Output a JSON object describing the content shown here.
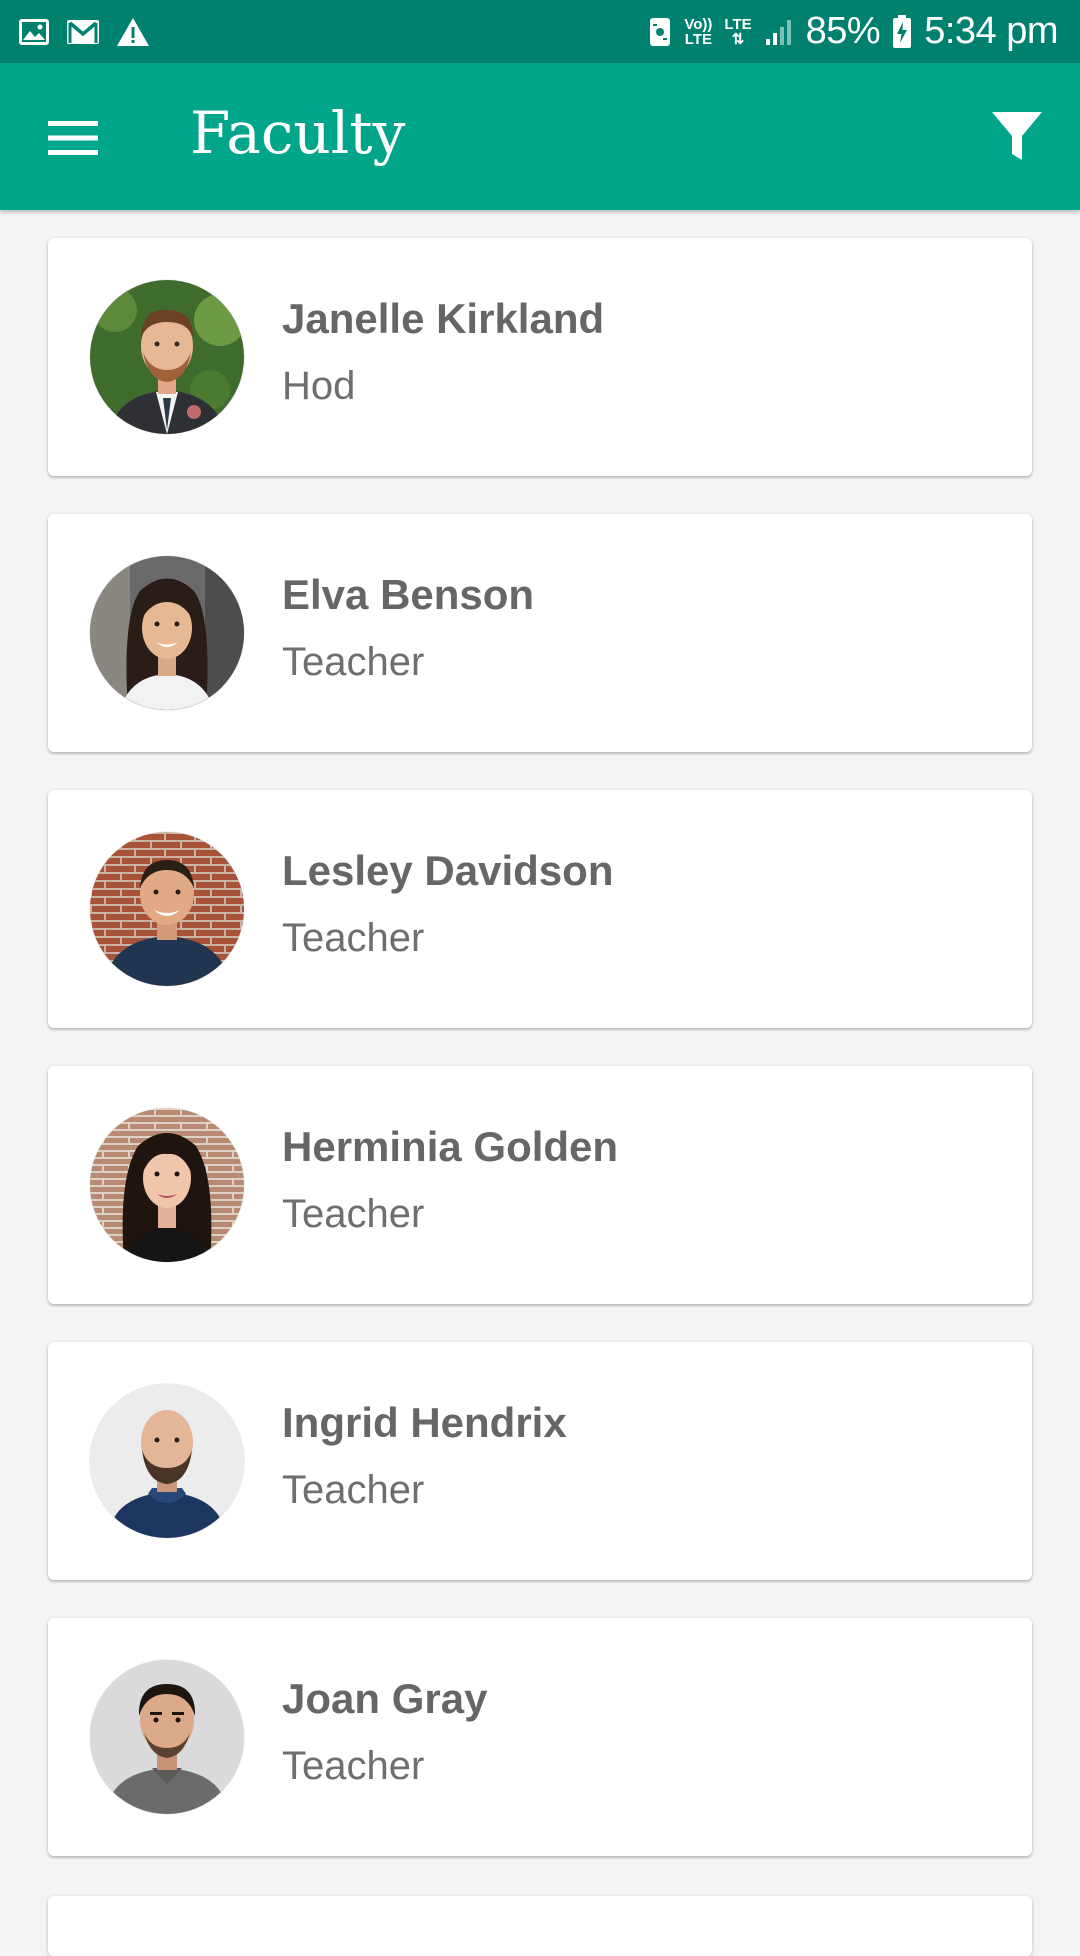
{
  "status_bar": {
    "left_icons": [
      "image-icon",
      "gmail-icon",
      "warning-icon"
    ],
    "right_icons": [
      "vibrate-icon",
      "volte-icon",
      "lte-icon",
      "signal-icon",
      "battery-charging-icon"
    ],
    "volte_label_top": "Vo))",
    "volte_label_bottom": "LTE",
    "lte_label": "LTE",
    "battery_percent": "85%",
    "time": "5:34 pm"
  },
  "app_bar": {
    "title": "Faculty",
    "menu_icon": "hamburger-menu-icon",
    "filter_icon": "filter-icon",
    "background_color": "#00a58a",
    "status_color": "#00806e"
  },
  "faculty": [
    {
      "name": "Janelle Kirkland",
      "role": "Hod",
      "avatar": "avatar-man-beard-suit"
    },
    {
      "name": "Elva Benson",
      "role": "Teacher",
      "avatar": "avatar-woman-smiling"
    },
    {
      "name": "Lesley Davidson",
      "role": "Teacher",
      "avatar": "avatar-man-brick-wall"
    },
    {
      "name": "Herminia Golden",
      "role": "Teacher",
      "avatar": "avatar-woman-dark-hair"
    },
    {
      "name": "Ingrid Hendrix",
      "role": "Teacher",
      "avatar": "avatar-man-bald-beard"
    },
    {
      "name": "Joan Gray",
      "role": "Teacher",
      "avatar": "avatar-man-gray-shirt"
    }
  ]
}
